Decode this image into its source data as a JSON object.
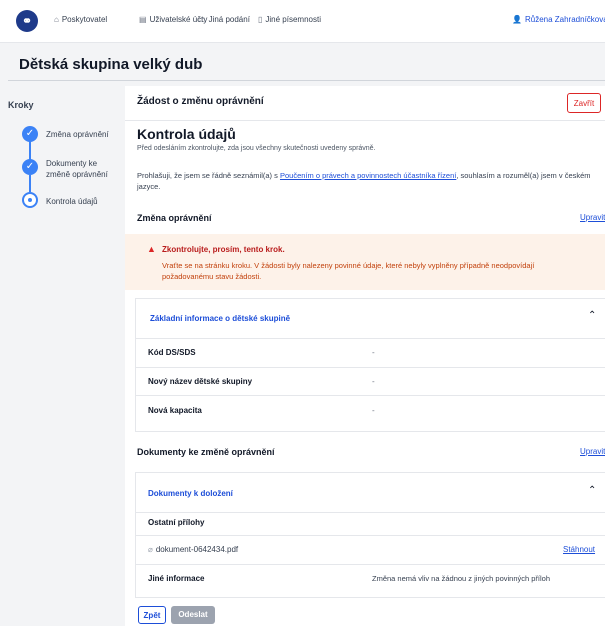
{
  "nav": {
    "items": [
      {
        "label": "Poskytovatel",
        "icon": "building-icon"
      },
      {
        "label": "Uživatelské účty",
        "icon": "database-icon"
      },
      {
        "label": "Jiná podání",
        "icon": "folder-icon"
      },
      {
        "label": "Jiné písemnosti",
        "icon": "book-icon"
      }
    ],
    "user": "Růžena Zahradníčková"
  },
  "page": {
    "title": "Dětská skupina velký dub"
  },
  "steps": {
    "title": "Kroky",
    "items": [
      {
        "label": "Změna oprávnění",
        "state": "done"
      },
      {
        "label": "Dokumenty ke změně oprávnění",
        "state": "done"
      },
      {
        "label": "Kontrola údajů",
        "state": "current"
      }
    ]
  },
  "main": {
    "header_title": "Žádost o změnu oprávnění",
    "close_label": "Zavřít",
    "heading": "Kontrola údajů",
    "subheading": "Před odesláním zkontrolujte, zda jsou všechny skutečnosti uvedeny správně.",
    "declaration_pre": "Prohlašuji, že jsem se řádně seznámil(a) s ",
    "declaration_link": "Poučením o právech a povinnostech účastníka řízení",
    "declaration_post": ", souhlasím a rozuměl(a) jsem v českém jazyce.",
    "section1": {
      "title": "Změna oprávnění",
      "edit_label": "Upravit",
      "warning_title": "Zkontrolujte, prosím, tento krok.",
      "warning_text": "Vraťte se na stránku kroku. V žádosti byly nalezeny povinné údaje, které nebyly vyplněny případně neodpovídají požadovanému stavu žádosti.",
      "accordion_title": "Základní informace o dětské skupině",
      "rows": [
        {
          "label": "Kód DS/SDS",
          "value": "-"
        },
        {
          "label": "Nový název dětské skupiny",
          "value": "-"
        },
        {
          "label": "Nová kapacita",
          "value": "-"
        }
      ]
    },
    "section2": {
      "title": "Dokumenty ke změně oprávnění",
      "edit_label": "Upravit",
      "accordion_title": "Dokumenty k doložení",
      "other_attachments_label": "Ostatní přílohy",
      "file_name": "dokument-0642434.pdf",
      "download_label": "Stáhnout",
      "other_info_label": "Jiné informace",
      "other_info_value": "Změna nemá vliv na žádnou z jiných povinných příloh"
    },
    "back_label": "Zpět",
    "send_label": "Odeslat"
  },
  "colors": {
    "accent": "#3b82f6",
    "link": "#1d4ed8",
    "danger": "#dc2626",
    "warning_bg": "#fdf2e9",
    "warning_text": "#c2410c"
  }
}
